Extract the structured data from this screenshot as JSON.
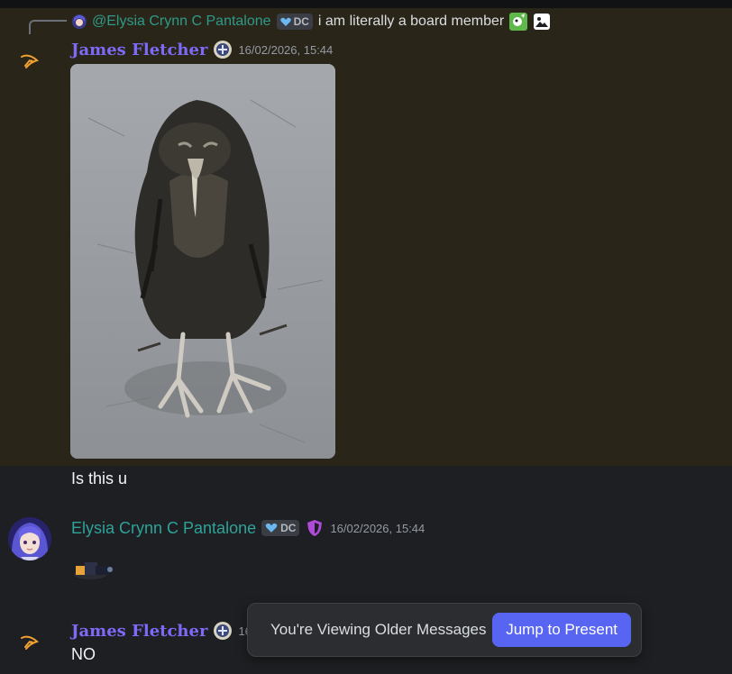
{
  "reply": {
    "mention": "@Elysia Crynn C Pantalone",
    "tag": "DC",
    "text": "i am literally a board member"
  },
  "messages": [
    {
      "author": "James Fletcher",
      "timestamp": "16/02/2026, 15:44",
      "attachment": "image",
      "text": "Is this u"
    },
    {
      "author": "Elysia Crynn C Pantalone",
      "tag": "DC",
      "timestamp": "16/02/2026, 15:44",
      "attachment": "sticker"
    },
    {
      "author": "James Fletcher",
      "timestamp_partial": "16/",
      "text": "NO"
    }
  ],
  "older_bar": {
    "label": "You're Viewing Older Messages",
    "button": "Jump to Present"
  },
  "colors": {
    "background": "#1e1f22",
    "highlight": "#2a2519",
    "name_james": "#7d6af7",
    "name_elysia": "#2ea39a",
    "button": "#5865f2"
  },
  "icons": [
    "reply-spine",
    "role-badge-icon",
    "heart-icon",
    "shield-icon",
    "image-icon",
    "reaction-icon"
  ]
}
